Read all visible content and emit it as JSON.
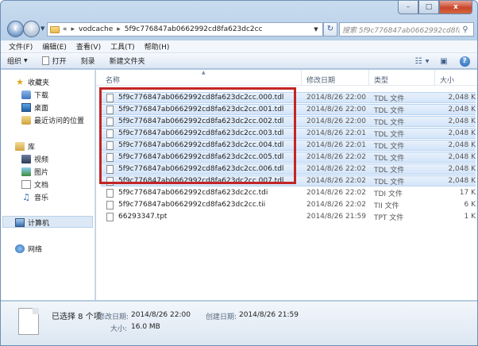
{
  "window": {
    "caption": {
      "minimize": "–",
      "maximize": "□",
      "close": "x"
    }
  },
  "address": {
    "overflow": "«",
    "crumbs": [
      "vodcache",
      "5f9c776847ab0662992cd8fa623dc2cc"
    ],
    "separator": "▸",
    "search_placeholder": "搜索 5f9c776847ab0662992cd8fa6..."
  },
  "menu": [
    "文件(F)",
    "编辑(E)",
    "查看(V)",
    "工具(T)",
    "帮助(H)"
  ],
  "commands": {
    "organize": "组织",
    "open": "打开",
    "burn": "刻录",
    "new_folder": "新建文件夹"
  },
  "nav": {
    "favorites": "收藏夹",
    "fav_items": [
      "下载",
      "桌面",
      "最近访问的位置"
    ],
    "libraries": "库",
    "lib_items": [
      "视频",
      "图片",
      "文档",
      "音乐"
    ],
    "computer": "计算机",
    "network": "网络"
  },
  "columns": {
    "name": "名称",
    "date": "修改日期",
    "type": "类型",
    "size": "大小"
  },
  "files": [
    {
      "name": "5f9c776847ab0662992cd8fa623dc2cc.000.tdl",
      "date": "2014/8/26 22:00",
      "type": "TDL 文件",
      "size": "2,048 K"
    },
    {
      "name": "5f9c776847ab0662992cd8fa623dc2cc.001.tdl",
      "date": "2014/8/26 22:00",
      "type": "TDL 文件",
      "size": "2,048 K"
    },
    {
      "name": "5f9c776847ab0662992cd8fa623dc2cc.002.tdl",
      "date": "2014/8/26 22:00",
      "type": "TDL 文件",
      "size": "2,048 K"
    },
    {
      "name": "5f9c776847ab0662992cd8fa623dc2cc.003.tdl",
      "date": "2014/8/26 22:01",
      "type": "TDL 文件",
      "size": "2,048 K"
    },
    {
      "name": "5f9c776847ab0662992cd8fa623dc2cc.004.tdl",
      "date": "2014/8/26 22:01",
      "type": "TDL 文件",
      "size": "2,048 K"
    },
    {
      "name": "5f9c776847ab0662992cd8fa623dc2cc.005.tdl",
      "date": "2014/8/26 22:02",
      "type": "TDL 文件",
      "size": "2,048 K"
    },
    {
      "name": "5f9c776847ab0662992cd8fa623dc2cc.006.tdl",
      "date": "2014/8/26 22:02",
      "type": "TDL 文件",
      "size": "2,048 K"
    },
    {
      "name": "5f9c776847ab0662992cd8fa623dc2cc.007.tdl",
      "date": "2014/8/26 22:02",
      "type": "TDL 文件",
      "size": "2,048 K"
    },
    {
      "name": "5f9c776847ab0662992cd8fa623dc2cc.tdi",
      "date": "2014/8/26 22:02",
      "type": "TDI 文件",
      "size": "17 K"
    },
    {
      "name": "5f9c776847ab0662992cd8fa623dc2cc.tii",
      "date": "2014/8/26 22:02",
      "type": "TII 文件",
      "size": "6 K"
    },
    {
      "name": "66293347.tpt",
      "date": "2014/8/26 21:59",
      "type": "TPT 文件",
      "size": "1 K"
    }
  ],
  "selected_count": 8,
  "details": {
    "selected": "已选择 8 个项",
    "modified_label": "修改日期:",
    "modified_value": "2014/8/26 22:00",
    "created_label": "创建日期:",
    "created_value": "2014/8/26 21:59",
    "size_label": "大小:",
    "size_value": "16.0 MB"
  },
  "colors": {
    "selection_outline": "#c32525",
    "selected_row": "#d3e5f9"
  }
}
